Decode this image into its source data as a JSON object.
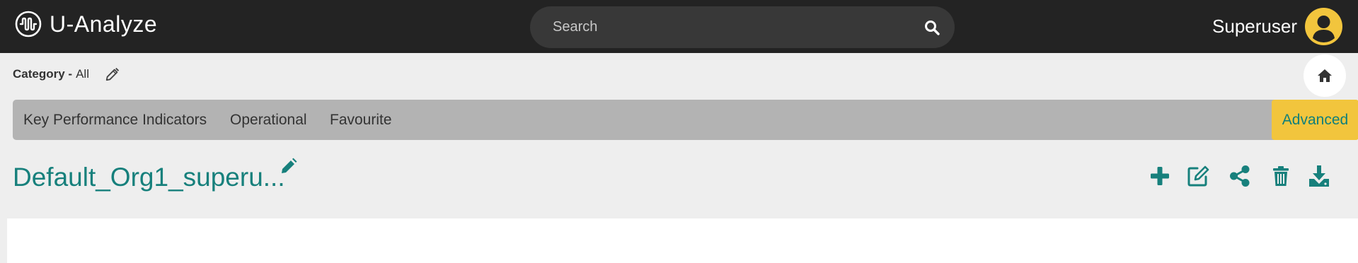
{
  "app": {
    "name": "U-Analyze"
  },
  "search": {
    "placeholder": "Search"
  },
  "user": {
    "name": "Superuser"
  },
  "category": {
    "label": "Category -",
    "value": "All"
  },
  "tabs": [
    {
      "label": "Key Performance Indicators"
    },
    {
      "label": "Operational"
    },
    {
      "label": "Favourite"
    },
    {
      "label": "Advanced",
      "selected": true
    }
  ],
  "dashboard": {
    "title": "Default_Org1_superu..."
  },
  "icons": {
    "logo": "waveform-circle-icon",
    "search": "search-icon",
    "avatar": "user-avatar-icon",
    "category_edit": "pencil-icon",
    "home": "home-icon",
    "title_edit": "pencil-icon",
    "actions": [
      "plus-icon",
      "edit-square-icon",
      "share-icon",
      "trash-icon",
      "download-icon"
    ]
  },
  "colors": {
    "topbar": "#232323",
    "accent_teal": "#17807c",
    "accent_yellow": "#f2c53d",
    "tabs_bg": "#b3b3b3",
    "page_bg": "#eeeeee"
  }
}
